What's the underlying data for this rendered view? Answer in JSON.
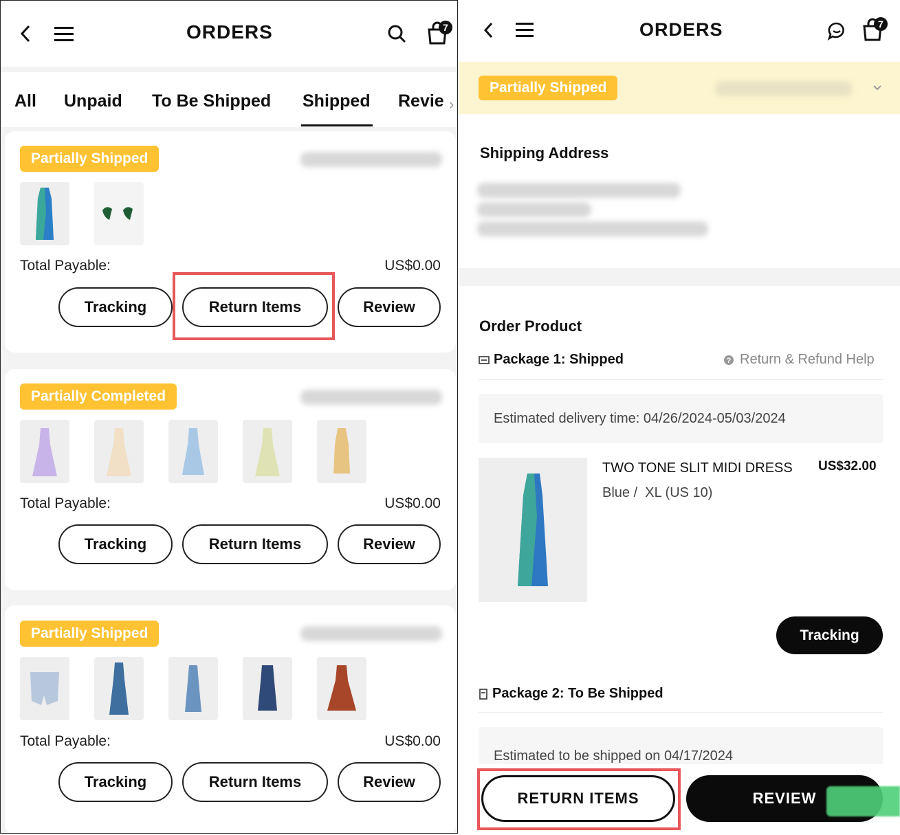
{
  "left": {
    "title": "ORDERS",
    "cart_count": "7",
    "tabs": [
      "All",
      "Unpaid",
      "To Be Shipped",
      "Shipped",
      "Revie"
    ],
    "active_tab": "Shipped",
    "orders": [
      {
        "status": "Partially Shipped",
        "payable_label": "Total Payable:",
        "amount": "US$0.00",
        "buttons": [
          "Tracking",
          "Return Items",
          "Review"
        ]
      },
      {
        "status": "Partially Completed",
        "payable_label": "Total Payable:",
        "amount": "US$0.00",
        "buttons": [
          "Tracking",
          "Return Items",
          "Review"
        ]
      },
      {
        "status": "Partially Shipped",
        "payable_label": "Total Payable:",
        "amount": "US$0.00",
        "buttons": [
          "Tracking",
          "Return Items",
          "Review"
        ]
      }
    ]
  },
  "right": {
    "title": "ORDERS",
    "cart_count": "7",
    "status": "Partially Shipped",
    "shipping_address_title": "Shipping Address",
    "order_product_title": "Order Product",
    "package1": {
      "label": "Package 1: Shipped",
      "help": "Return & Refund Help",
      "estimate": "Estimated delivery time: 04/26/2024-05/03/2024"
    },
    "product": {
      "name": "TWO TONE SLIT MIDI DRESS",
      "price": "US$32.00",
      "variant": "Blue /  XL (US 10)"
    },
    "tracking_button": "Tracking",
    "package2": {
      "label": "Package 2: To Be Shipped",
      "estimate": "Estimated to be shipped on 04/17/2024"
    },
    "return_button": "RETURN ITEMS",
    "review_button": "REVIEW"
  },
  "colors": {
    "badge": "#ffc233",
    "highlight": "#e8585a",
    "yellow_bar": "#fdf5cf"
  }
}
